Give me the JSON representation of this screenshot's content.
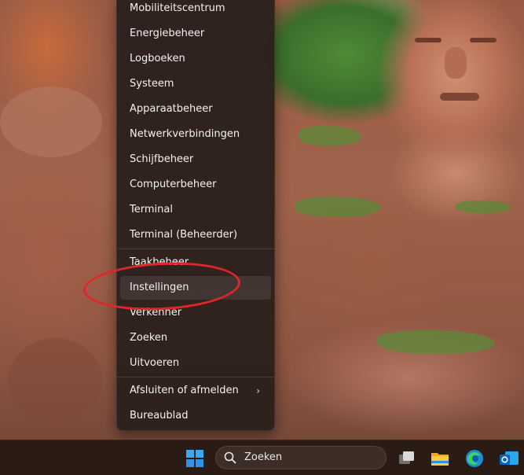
{
  "menu": {
    "items": [
      {
        "label": "Mobiliteitscentrum"
      },
      {
        "label": "Energiebeheer"
      },
      {
        "label": "Logboeken"
      },
      {
        "label": "Systeem"
      },
      {
        "label": "Apparaatbeheer"
      },
      {
        "label": "Netwerkverbindingen"
      },
      {
        "label": "Schijfbeheer"
      },
      {
        "label": "Computerbeheer"
      },
      {
        "label": "Terminal"
      },
      {
        "label": "Terminal (Beheerder)"
      },
      {
        "label": "Taakbeheer"
      },
      {
        "label": "Instellingen"
      },
      {
        "label": "Verkenner"
      },
      {
        "label": "Zoeken"
      },
      {
        "label": "Uitvoeren"
      },
      {
        "label": "Afsluiten of afmelden"
      },
      {
        "label": "Bureaublad"
      }
    ],
    "hovered_item": "Instellingen",
    "submenu_chevron": "›"
  },
  "annotation": {
    "color": "#e0262b",
    "shape": "ellipse",
    "target": "Instellingen"
  },
  "taskbar": {
    "search_label": "Zoeken",
    "icons": [
      "windows-start-icon",
      "search-icon",
      "task-view-icon",
      "file-explorer-icon",
      "edge-icon",
      "outlook-icon"
    ]
  },
  "colors": {
    "menu_bg": "#2c201c",
    "menu_text": "#f2f2f2",
    "taskbar_bg": "#2a1b14",
    "accent_blue": "#2f9bf0"
  }
}
